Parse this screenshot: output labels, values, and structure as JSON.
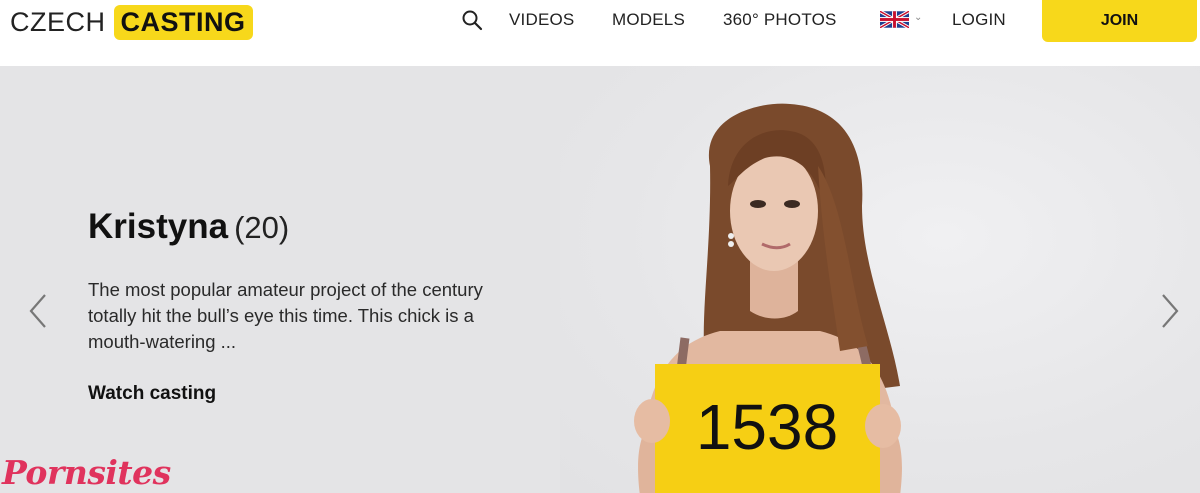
{
  "header": {
    "logo_left": "CZECH",
    "logo_right": "CASTING",
    "nav": {
      "videos": "VIDEOS",
      "models": "MODELS",
      "photos": "360° PHOTOS",
      "login": "LOGIN",
      "join": "JOIN"
    },
    "language": "en-gb-flag-icon"
  },
  "hero": {
    "name": "Kristyna",
    "age": "(20)",
    "description": "The most popular amateur project of the century totally hit the bull’s eye this time. This chick is a mouth-watering ...",
    "cta": "Watch casting",
    "sign_number": "1538"
  },
  "watermark": "Pornsites",
  "colors": {
    "accent": "#f7d81b",
    "hero_bg": "#e4e4e6",
    "watermark": "#e0335d"
  }
}
